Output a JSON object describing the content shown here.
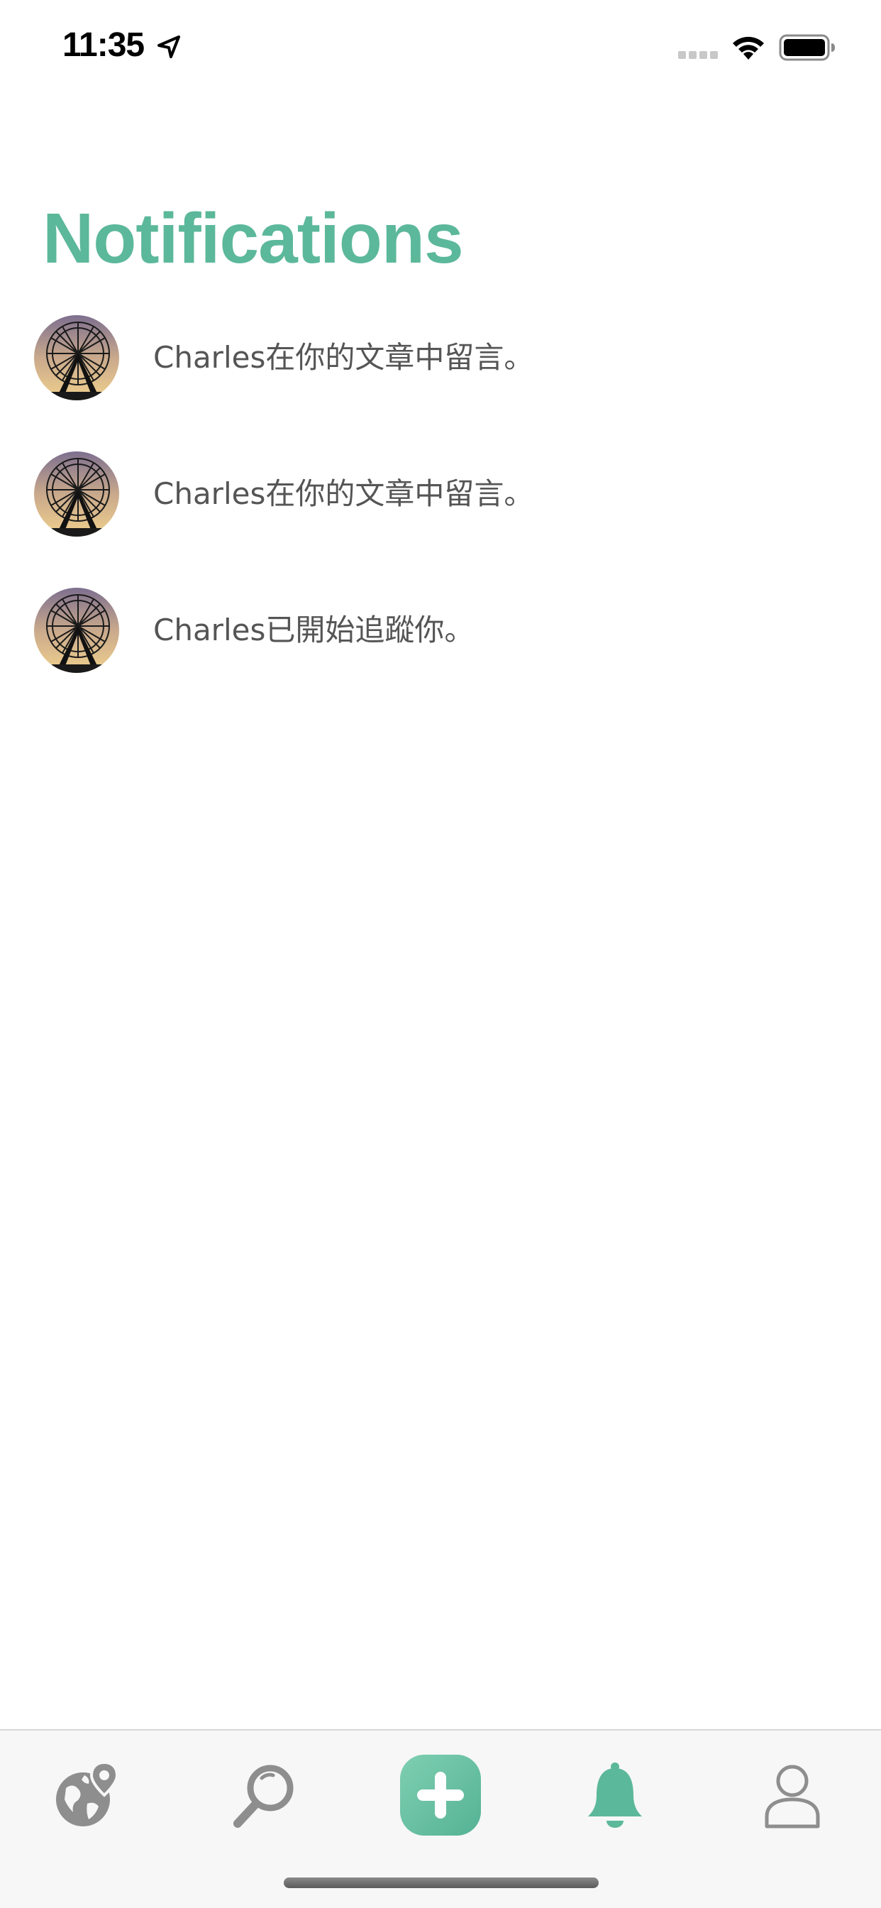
{
  "status_bar": {
    "time": "11:35",
    "location_icon": "location-arrow-icon",
    "signal_icon": "cellular-signal-icon",
    "wifi_icon": "wifi-icon",
    "battery_icon": "battery-icon"
  },
  "header": {
    "title": "Notifications"
  },
  "notifications": [
    {
      "avatar": "ferris-wheel-avatar",
      "text": "Charles在你的文章中留言。"
    },
    {
      "avatar": "ferris-wheel-avatar",
      "text": "Charles在你的文章中留言。"
    },
    {
      "avatar": "ferris-wheel-avatar",
      "text": "Charles已開始追蹤你。"
    }
  ],
  "tab_bar": {
    "tabs": [
      {
        "icon": "globe-pin-icon",
        "selected": false
      },
      {
        "icon": "search-icon",
        "selected": false
      },
      {
        "icon": "add-post-icon",
        "selected": false
      },
      {
        "icon": "bell-icon",
        "selected": true
      },
      {
        "icon": "user-icon",
        "selected": false
      }
    ]
  },
  "colors": {
    "accent": "#5cb89a",
    "text": "#555555",
    "tab_inactive": "#8e8e8e",
    "tab_bar_background": "#f7f7f7"
  }
}
